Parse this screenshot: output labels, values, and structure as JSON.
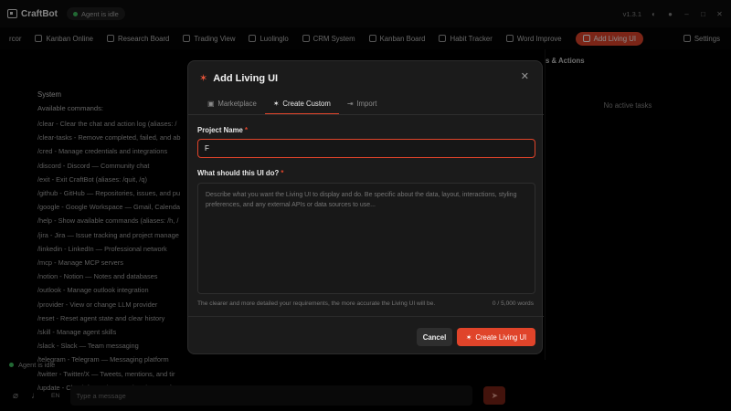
{
  "app": {
    "name": "CraftBot",
    "agent_status": "Agent is idle",
    "version": "v1.3.1"
  },
  "nav": {
    "items": [
      {
        "label": "rcor"
      },
      {
        "label": "Kanban Online"
      },
      {
        "label": "Research Board"
      },
      {
        "label": "Trading View"
      },
      {
        "label": "Luolinglo"
      },
      {
        "label": "CRM System"
      },
      {
        "label": "Kanban Board"
      },
      {
        "label": "Habit Tracker"
      },
      {
        "label": "Word Improve"
      }
    ],
    "active_label": "Add Living UI",
    "settings_label": "Settings"
  },
  "chat": {
    "system_label": "System",
    "subtitle": "Available commands:",
    "commands": [
      "/clear - Clear the chat and action log (aliases: /",
      "/clear-tasks - Remove completed, failed, and ab",
      "/cred - Manage credentials and integrations",
      "/discord - Discord — Community chat",
      "/exit - Exit CraftBot (aliases: /quit, /q)",
      "/github - GitHub — Repositories, issues, and pu",
      "/google - Google Workspace — Gmail, Calenda",
      "/help - Show available commands (aliases: /h, /",
      "/jira - Jira — Issue tracking and project manage",
      "/linkedin - LinkedIn — Professional network",
      "/mcp - Manage MCP servers",
      "/notion - Notion — Notes and databases",
      "/outlook - Manage outlook integration",
      "/provider - View or change LLM provider",
      "/reset - Reset agent state and clear history",
      "/skill - Manage agent skills",
      "/slack - Slack — Team messaging",
      "/telegram - Telegram — Messaging platform",
      "/twitter - Twitter/X — Tweets, mentions, and tir",
      "/update - Check for updates and update CraftB"
    ],
    "status": "Agent is idle",
    "input_placeholder": "Type a message",
    "lang": "EN"
  },
  "right_panel": {
    "title": "s & Actions",
    "empty": "No active tasks"
  },
  "modal": {
    "title": "Add Living UI",
    "tabs": [
      {
        "label": "Marketplace"
      },
      {
        "label": "Create Custom"
      },
      {
        "label": "Import"
      }
    ],
    "project_label": "Project Name",
    "project_value": "F",
    "desc_label": "What should this UI do?",
    "desc_placeholder": "Describe what you want the Living UI to display and do. Be specific about the data, layout, interactions, styling preferences, and any external APIs or data sources to use...",
    "hint": "The clearer and more detailed your requirements, the more accurate the Living UI will be.",
    "word_count": "0 / 5,000 words",
    "cancel_label": "Cancel",
    "create_label": "Create Living UI",
    "required_mark": "*"
  },
  "colors": {
    "accent": "#e0442a",
    "background": "#000000",
    "modal_bg": "#1b1b1b"
  }
}
